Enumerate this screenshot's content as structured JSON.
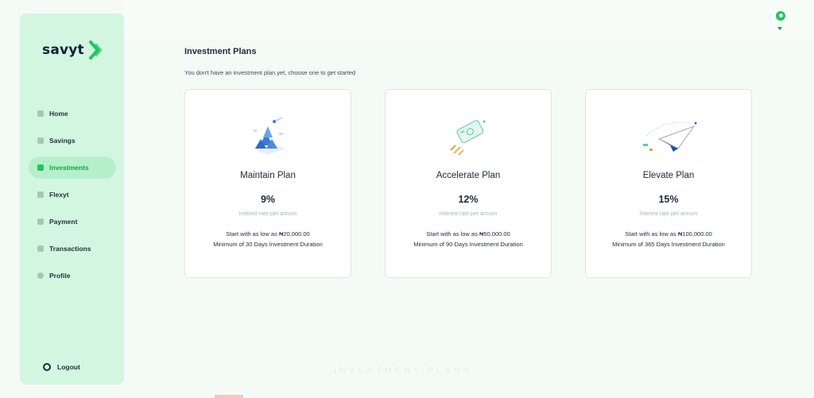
{
  "app": {
    "logo_text": "savyt"
  },
  "sidebar": {
    "items": [
      {
        "label": "Home",
        "icon": "grid-icon"
      },
      {
        "label": "Savings",
        "icon": "piggy-bank-icon"
      },
      {
        "label": "Investments",
        "icon": "investments-icon",
        "active": true
      },
      {
        "label": "Flexyt",
        "icon": "folder-icon"
      },
      {
        "label": "Payment",
        "icon": "payment-icon"
      },
      {
        "label": "Transactions",
        "icon": "transactions-icon"
      },
      {
        "label": "Profile",
        "icon": "user-icon"
      }
    ],
    "logout_label": "Logout"
  },
  "main": {
    "title": "Investment Plans",
    "subtitle": "You don't have an investment plan yet, choose one to get started",
    "plans": [
      {
        "title": "Maintain Plan",
        "rate": "9%",
        "rate_label": "Interest rate per annum",
        "minimum": "Start with as low as ₦20,000.00",
        "duration": "Minimum of 30 Days Investment Duration",
        "illustration": "stacked-blocks-illustration"
      },
      {
        "title": "Accelerate Plan",
        "rate": "12%",
        "rate_label": "Interest rate per annum",
        "minimum": "Start with as low as ₦50,000.00",
        "duration": "Minimum of 90 Days Investment Duration",
        "illustration": "flying-card-illustration"
      },
      {
        "title": "Elevate Plan",
        "rate": "15%",
        "rate_label": "Interest rate per annum",
        "minimum": "Start with as low as ₦100,000.00",
        "duration": "Minimum of 365 Days Investment Duration",
        "illustration": "paper-plane-illustration"
      }
    ]
  },
  "footer_watermark": "INVESTMENT PLANS",
  "colors": {
    "accent": "#22c55e",
    "sidebar_bg": "#d3f6e1",
    "active_bg": "#b6f0ca",
    "text": "#1a2b3c"
  }
}
